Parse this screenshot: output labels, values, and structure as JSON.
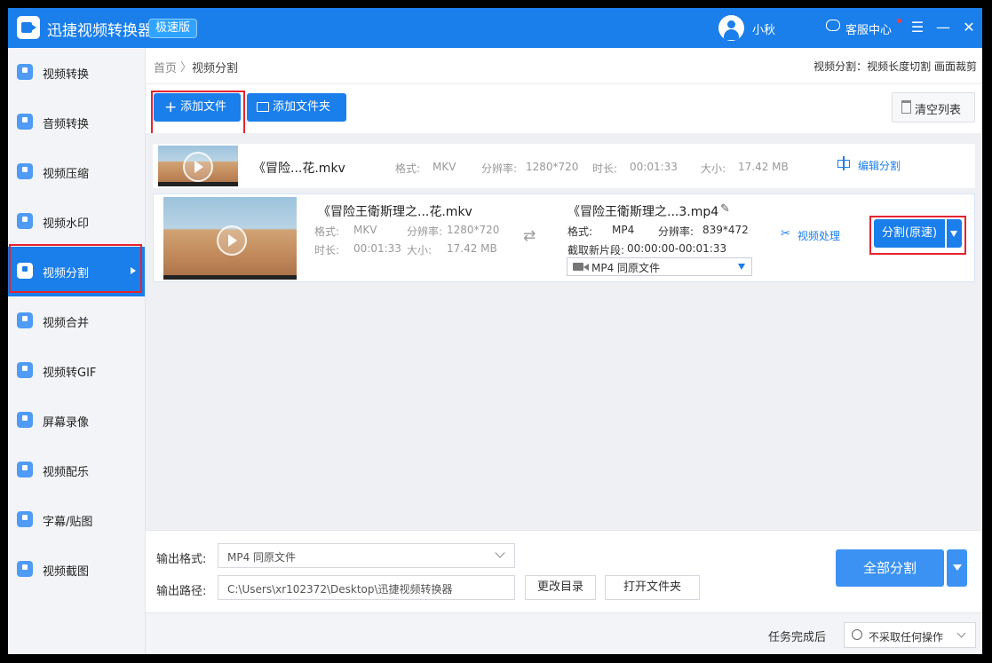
{
  "app": {
    "title": "迅捷视频转换器",
    "edition": "极速版",
    "username": "小秋",
    "service": "客服中心"
  },
  "sidebar": {
    "items": [
      {
        "label": "视频转换",
        "icon": "video-convert-icon"
      },
      {
        "label": "音频转换",
        "icon": "audio-convert-icon"
      },
      {
        "label": "视频压缩",
        "icon": "video-compress-icon"
      },
      {
        "label": "视频水印",
        "icon": "video-watermark-icon"
      },
      {
        "label": "视频分割",
        "icon": "video-split-icon",
        "active": true
      },
      {
        "label": "视频合并",
        "icon": "video-merge-icon"
      },
      {
        "label": "视频转GIF",
        "icon": "gif-icon"
      },
      {
        "label": "屏幕录像",
        "icon": "screen-record-icon"
      },
      {
        "label": "视频配乐",
        "icon": "music-icon"
      },
      {
        "label": "字幕/贴图",
        "icon": "subtitle-icon"
      },
      {
        "label": "视频截图",
        "icon": "screenshot-icon"
      }
    ]
  },
  "breadcrumb": {
    "home": "首页",
    "separator": "〉",
    "current": "视频分割",
    "right": "视频分割：视频长度切割 画面裁剪"
  },
  "toolbar": {
    "add_file": "添加文件",
    "add_folder": "添加文件夹",
    "clear_list": "清空列表"
  },
  "files": {
    "row1": {
      "name": "《冒险...花.mkv",
      "format_label": "格式:",
      "format": "MKV",
      "resolution_label": "分辨率:",
      "resolution": "1280*720",
      "duration_label": "时长:",
      "duration": "00:01:33",
      "size_label": "大小:",
      "size": "17.42 MB",
      "edit_split": "编辑分割"
    },
    "row2": {
      "source_name": "《冒险王衛斯理之...花.mkv",
      "format_label": "格式:",
      "format": "MKV",
      "resolution_label": "分辨率:",
      "resolution": "1280*720",
      "duration_label": "时长:",
      "duration": "00:01:33",
      "size_label": "大小:",
      "size": "17.42 MB",
      "output_name": "《冒险王衛斯理之...3.mp4",
      "out_format_label": "格式:",
      "out_format": "MP4",
      "out_resolution_label": "分辨率:",
      "out_resolution": "839*472",
      "clip_label": "截取新片段:",
      "clip": "00:00:00-00:01:33",
      "output_select": "MP4   同原文件",
      "video_process": "视频处理",
      "split_button": "分割(原速)"
    }
  },
  "output": {
    "format_label": "输出格式:",
    "format_value": "MP4   同原文件",
    "path_label": "输出路径:",
    "path_value": "C:\\Users\\xr102372\\Desktop\\迅捷视频转换器",
    "change_dir": "更改目录",
    "open_folder": "打开文件夹",
    "split_all": "全部分割"
  },
  "status": {
    "after_label": "任务完成后",
    "after_value": "不采取任何操作"
  },
  "colors": {
    "brand": "#1a7eeb",
    "highlight": "#e8232f"
  }
}
